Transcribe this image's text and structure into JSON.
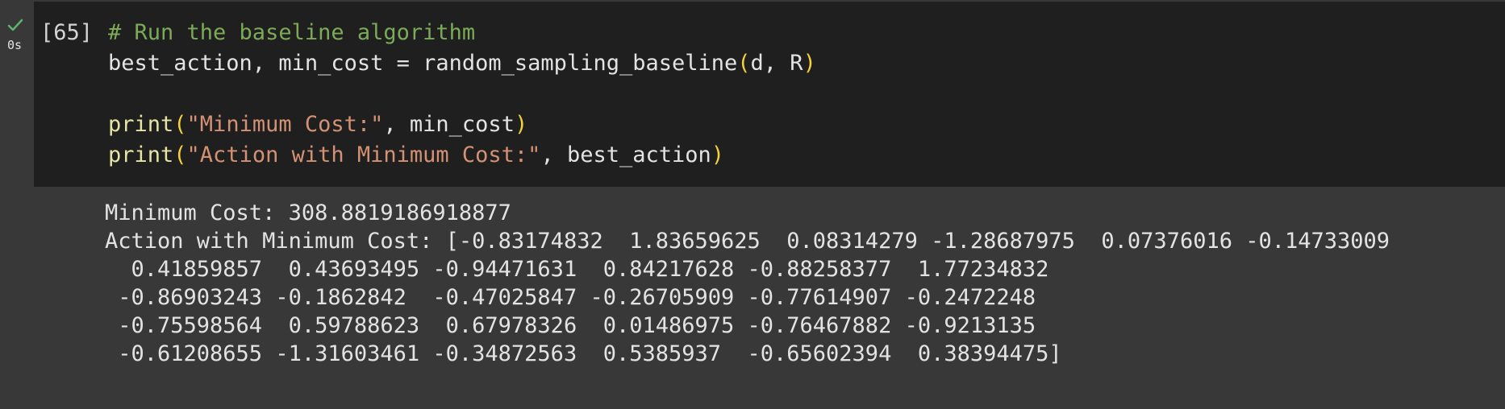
{
  "cell": {
    "execution_count": "[65]",
    "execution_time": "0s",
    "status_icon": "checkmark-icon",
    "code_lines": [
      [
        {
          "text": "# Run the baseline algorithm",
          "kind": "comment"
        }
      ],
      [
        {
          "text": "best_action, min_cost = random_sampling_baseline",
          "kind": "plain"
        },
        {
          "text": "(",
          "kind": "paren"
        },
        {
          "text": "d, R",
          "kind": "plain"
        },
        {
          "text": ")",
          "kind": "paren"
        }
      ],
      [],
      [
        {
          "text": "print",
          "kind": "func"
        },
        {
          "text": "(",
          "kind": "paren"
        },
        {
          "text": "\"Minimum Cost:\"",
          "kind": "str"
        },
        {
          "text": ", min_cost",
          "kind": "plain"
        },
        {
          "text": ")",
          "kind": "paren"
        }
      ],
      [
        {
          "text": "print",
          "kind": "func"
        },
        {
          "text": "(",
          "kind": "paren"
        },
        {
          "text": "\"Action with Minimum Cost:\"",
          "kind": "str"
        },
        {
          "text": ", best_action",
          "kind": "plain"
        },
        {
          "text": ")",
          "kind": "paren"
        }
      ]
    ],
    "output_lines": [
      "Minimum Cost: 308.8819186918877",
      "Action with Minimum Cost: [-0.83174832  1.83659625  0.08314279 -1.28687975  0.07376016 -0.14733009",
      "  0.41859857  0.43693495 -0.94471631  0.84217628 -0.88258377  1.77234832",
      " -0.86903243 -0.1862842  -0.47025847 -0.26705909 -0.77614907 -0.2472248",
      " -0.75598564  0.59788623  0.67978326  0.01486975 -0.76467882 -0.9213135",
      " -0.61208655 -1.31603461 -0.34872563  0.5385937  -0.65602394  0.38394475]"
    ]
  },
  "colors": {
    "code_background": "#1f1f1f",
    "output_background": "#383838",
    "comment": "#7cab58",
    "function": "#e5e5a4",
    "paren": "#f2d13c",
    "string": "#d49174",
    "text": "#e3e3e3",
    "success_check": "#5fb36a"
  }
}
